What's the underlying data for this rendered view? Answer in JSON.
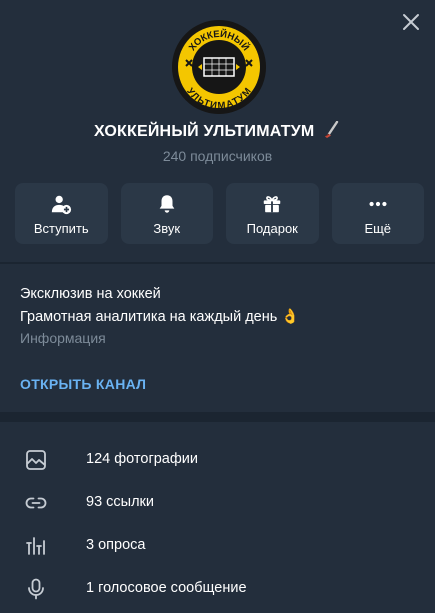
{
  "channel": {
    "title": "ХОККЕЙНЫЙ УЛЬТИМАТУМ",
    "subscribers": "240 подписчиков",
    "logo_text": {
      "top": "ХОККЕЙНЫЙ",
      "bottom": "УЛЬТИМАТУМ"
    }
  },
  "actions": [
    {
      "label": "Вступить",
      "icon": "add-user-icon"
    },
    {
      "label": "Звук",
      "icon": "bell-icon"
    },
    {
      "label": "Подарок",
      "icon": "gift-icon"
    },
    {
      "label": "Ещё",
      "icon": "more-icon"
    }
  ],
  "info": {
    "description_line1": "Эксклюзив на хоккей",
    "description_line2": "Грамотная аналитика на каждый день 👌",
    "description_label": "Информация",
    "open_channel": "ОТКРЫТЬ КАНАЛ"
  },
  "media": [
    {
      "label": "124 фотографии",
      "icon": "photo-icon"
    },
    {
      "label": "93 ссылки",
      "icon": "link-icon"
    },
    {
      "label": "3 опроса",
      "icon": "poll-icon"
    },
    {
      "label": "1 голосовое сообщение",
      "icon": "microphone-icon"
    }
  ],
  "colors": {
    "background": "#1b2531",
    "panel": "#232e3c",
    "button": "#2b3847",
    "accent": "#6ab3f3",
    "muted": "#7d8b99",
    "logo_yellow": "#f4c600"
  }
}
